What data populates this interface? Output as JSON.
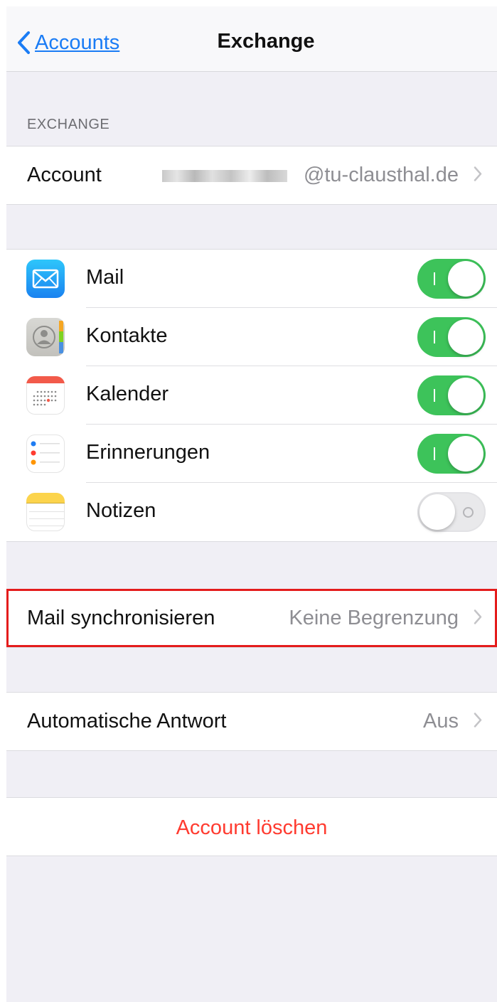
{
  "nav": {
    "back_label": "Accounts",
    "title": "Exchange"
  },
  "exchange_section": {
    "header": "EXCHANGE",
    "account_label": "Account",
    "account_value": "@tu-clausthal.de"
  },
  "services": [
    {
      "label": "Mail",
      "icon": "mail-icon",
      "enabled": true
    },
    {
      "label": "Kontakte",
      "icon": "contacts-icon",
      "enabled": true
    },
    {
      "label": "Kalender",
      "icon": "calendar-icon",
      "enabled": true
    },
    {
      "label": "Erinnerungen",
      "icon": "reminders-icon",
      "enabled": true
    },
    {
      "label": "Notizen",
      "icon": "notes-icon",
      "enabled": false
    }
  ],
  "mail_sync": {
    "label": "Mail synchronisieren",
    "value": "Keine Begrenzung"
  },
  "auto_reply": {
    "label": "Automatische Antwort",
    "value": "Aus"
  },
  "delete_account": {
    "label": "Account löschen"
  },
  "colors": {
    "accent": "#1a7cf5",
    "toggle_on": "#3dc35a",
    "destructive": "#ff3b30",
    "highlight_border": "#e41c1c"
  }
}
